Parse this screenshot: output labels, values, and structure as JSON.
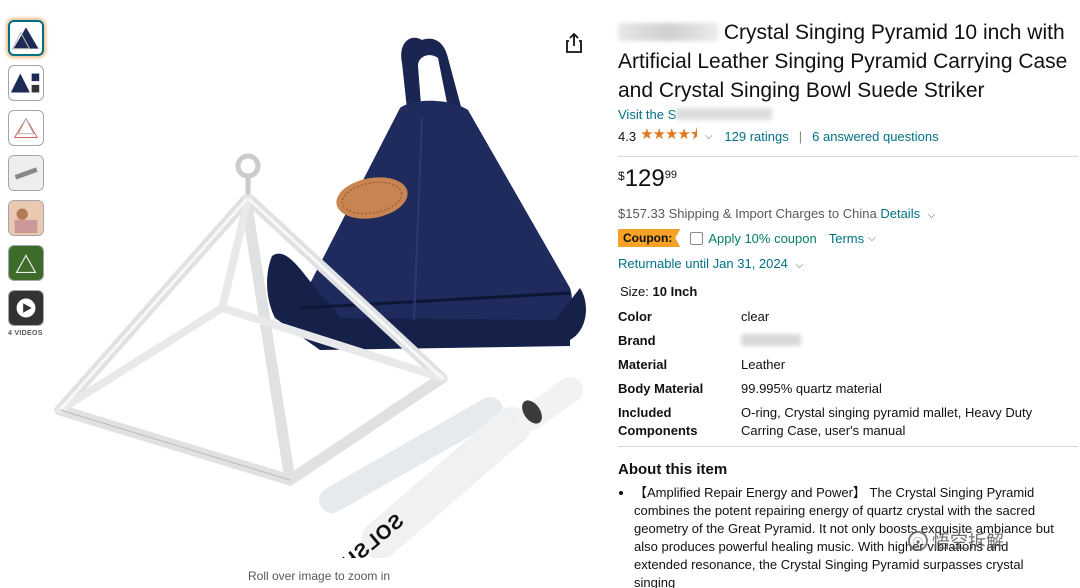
{
  "thumbnails": {
    "count_label": "4 VIDEOS"
  },
  "main_image": {
    "tube_brand": "SOLSHINE",
    "zoom_hint": "Roll over image to zoom in"
  },
  "product": {
    "title": "Crystal Singing Pyramid 10 inch with Artificial Leather Singing Pyramid Carrying Case and Crystal Singing Bowl Suede Striker",
    "store_link": "Visit the S",
    "rating": "4.3",
    "stars": "★★★★⯨",
    "ratings_count": "129 ratings",
    "answered": "6 answered questions",
    "price_symbol": "$",
    "price_whole": "129",
    "price_fraction": "99",
    "shipping": "$157.33 Shipping & Import Charges to China",
    "shipping_details": "Details",
    "coupon_badge": "Coupon:",
    "coupon_text": "Apply 10% coupon",
    "coupon_terms": "Terms",
    "returnable": "Returnable until Jan 31, 2024",
    "size_label": "Size:",
    "size_value": "10 Inch"
  },
  "specs": [
    {
      "key": "Color",
      "value": "clear"
    },
    {
      "key": "Brand",
      "value": ""
    },
    {
      "key": "Material",
      "value": "Leather"
    },
    {
      "key": "Body Material",
      "value": "99.995% quartz material"
    },
    {
      "key": "Included Components",
      "value": "O-ring, Crystal singing pyramid mallet, Heavy Duty Carring Case, user's manual"
    }
  ],
  "about": {
    "title": "About this item",
    "bullet_1": "【Amplified Repair Energy and Power】 The Crystal Singing Pyramid combines the potent repairing energy of quartz crystal with the sacred geometry of the Great Pyramid. It not only boosts exquisite ambiance but also produces powerful healing music. With higher vibrations and extended resonance, the Crystal Singing Pyramid surpasses crystal singing"
  },
  "watermark": {
    "text": "悟空拆解"
  },
  "colors": {
    "link": "#007185",
    "star": "#DE7921",
    "coupon_badge": "#F7A126",
    "coupon_text": "#067D62",
    "case_navy": "#1d2a55"
  }
}
